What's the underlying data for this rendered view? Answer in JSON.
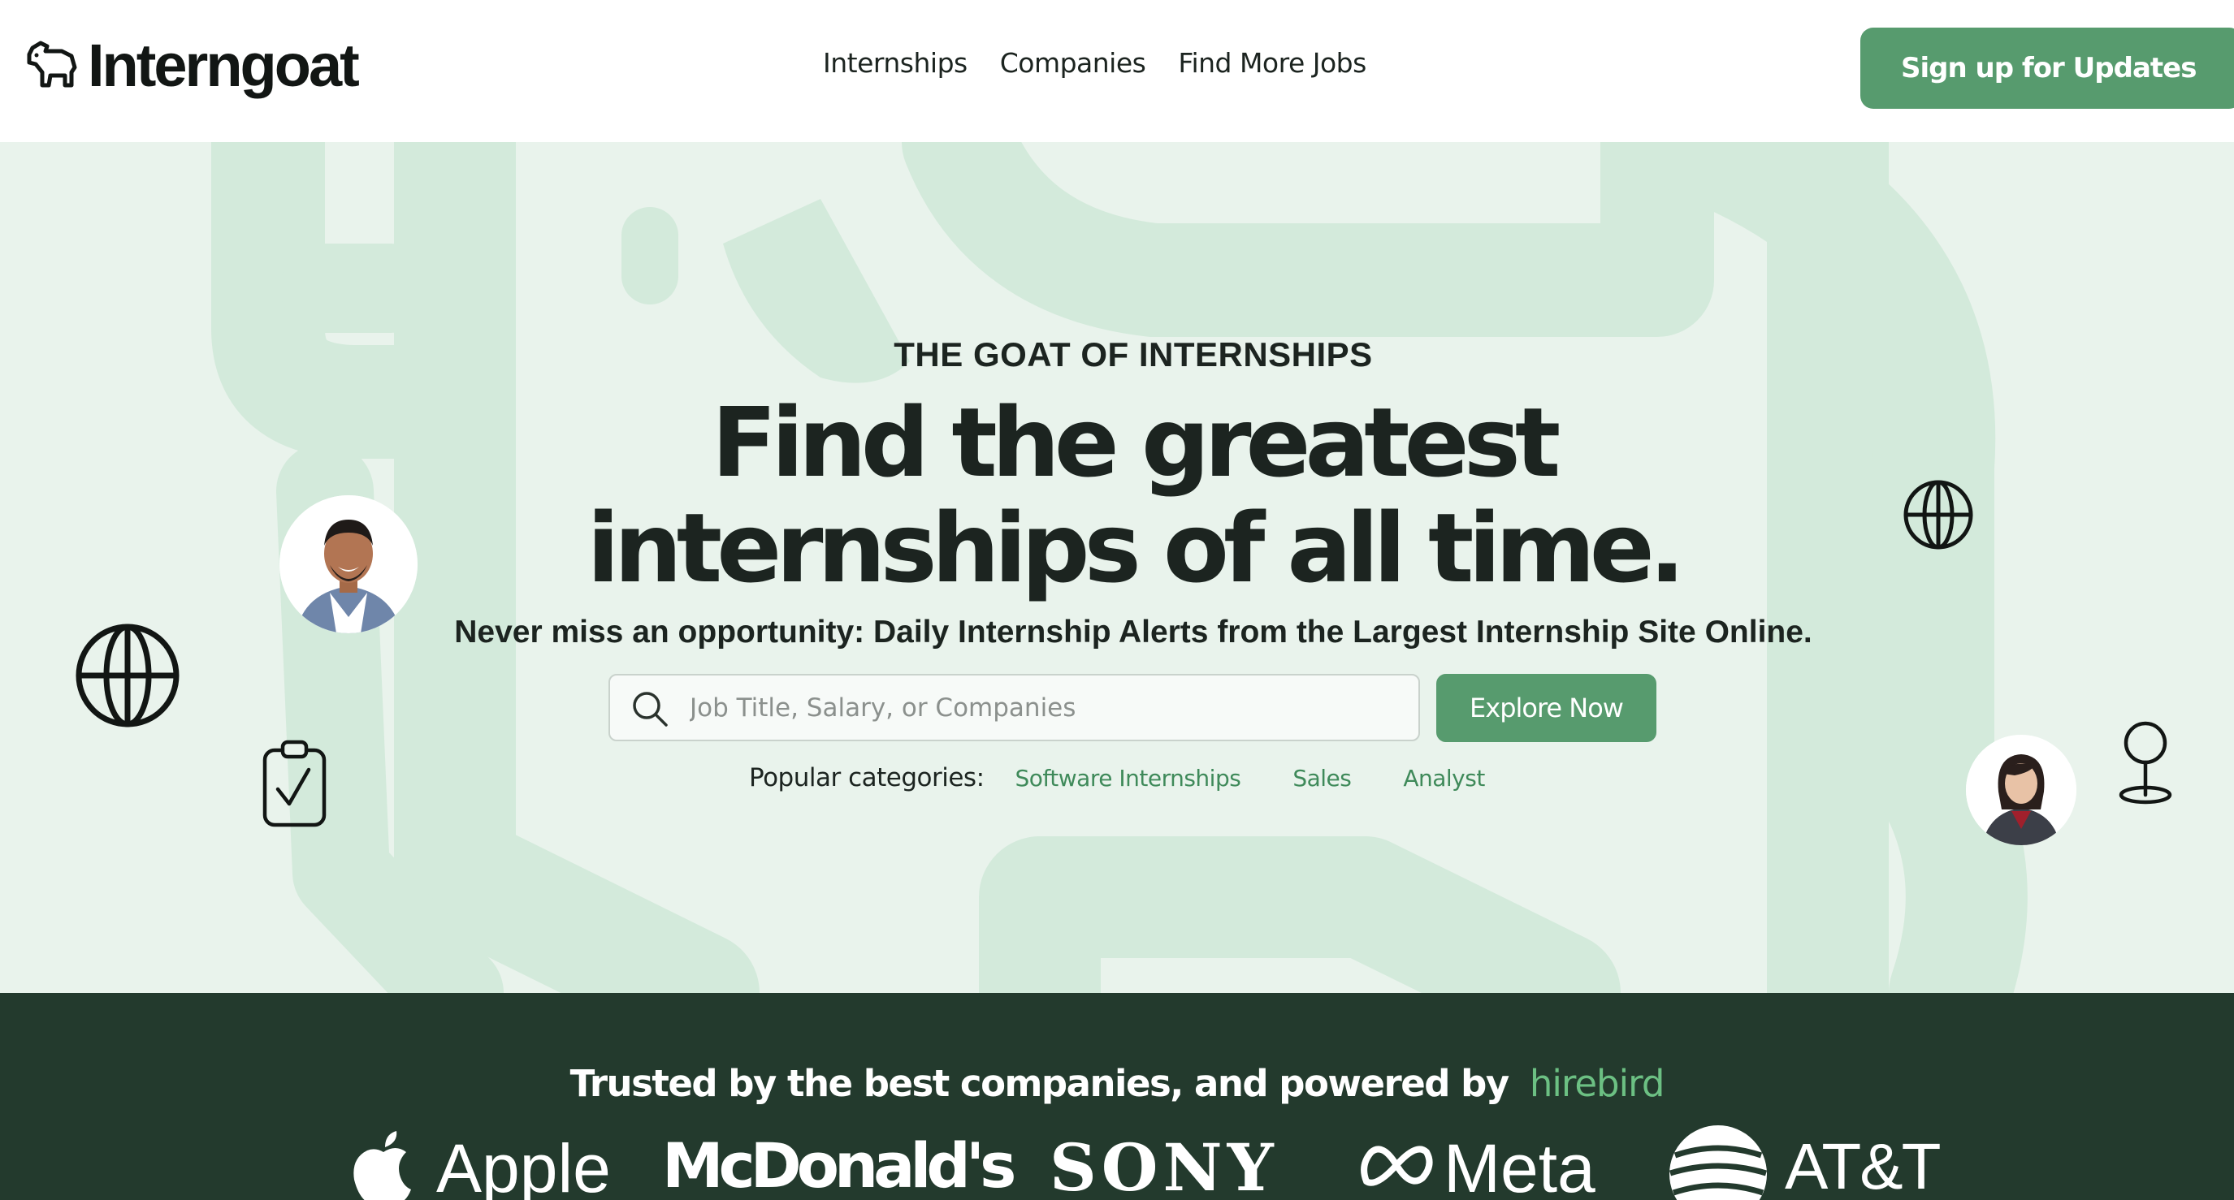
{
  "header": {
    "logo_text": "Interngoat",
    "nav": [
      {
        "label": "Internships"
      },
      {
        "label": "Companies"
      },
      {
        "label": "Find More Jobs"
      }
    ],
    "cta_label": "Sign up for Updates"
  },
  "hero": {
    "eyebrow": "THE GOAT OF INTERNSHIPS",
    "headline_line1": "Find the greatest",
    "headline_line2": "internships of all time.",
    "subhead": "Never miss an opportunity: Daily Internship Alerts from the Largest Internship Site Online.",
    "search": {
      "placeholder": "Job Title, Salary, or Companies",
      "value": ""
    },
    "explore_label": "Explore Now",
    "popular_label": "Popular categories:",
    "categories": [
      "Software Internships",
      "Sales",
      "Analyst"
    ]
  },
  "trusted": {
    "title": "Trusted by the best companies, and powered by",
    "powered_by": "hirebird",
    "brands": [
      "Apple",
      "McDonald's",
      "SONY",
      "Meta",
      "AT&T"
    ]
  },
  "colors": {
    "accent": "#579b6e",
    "hero_bg": "#e9f3ec",
    "band_bg": "#233a2d",
    "link": "#3f8a5a",
    "hirebird": "#6cc083"
  }
}
